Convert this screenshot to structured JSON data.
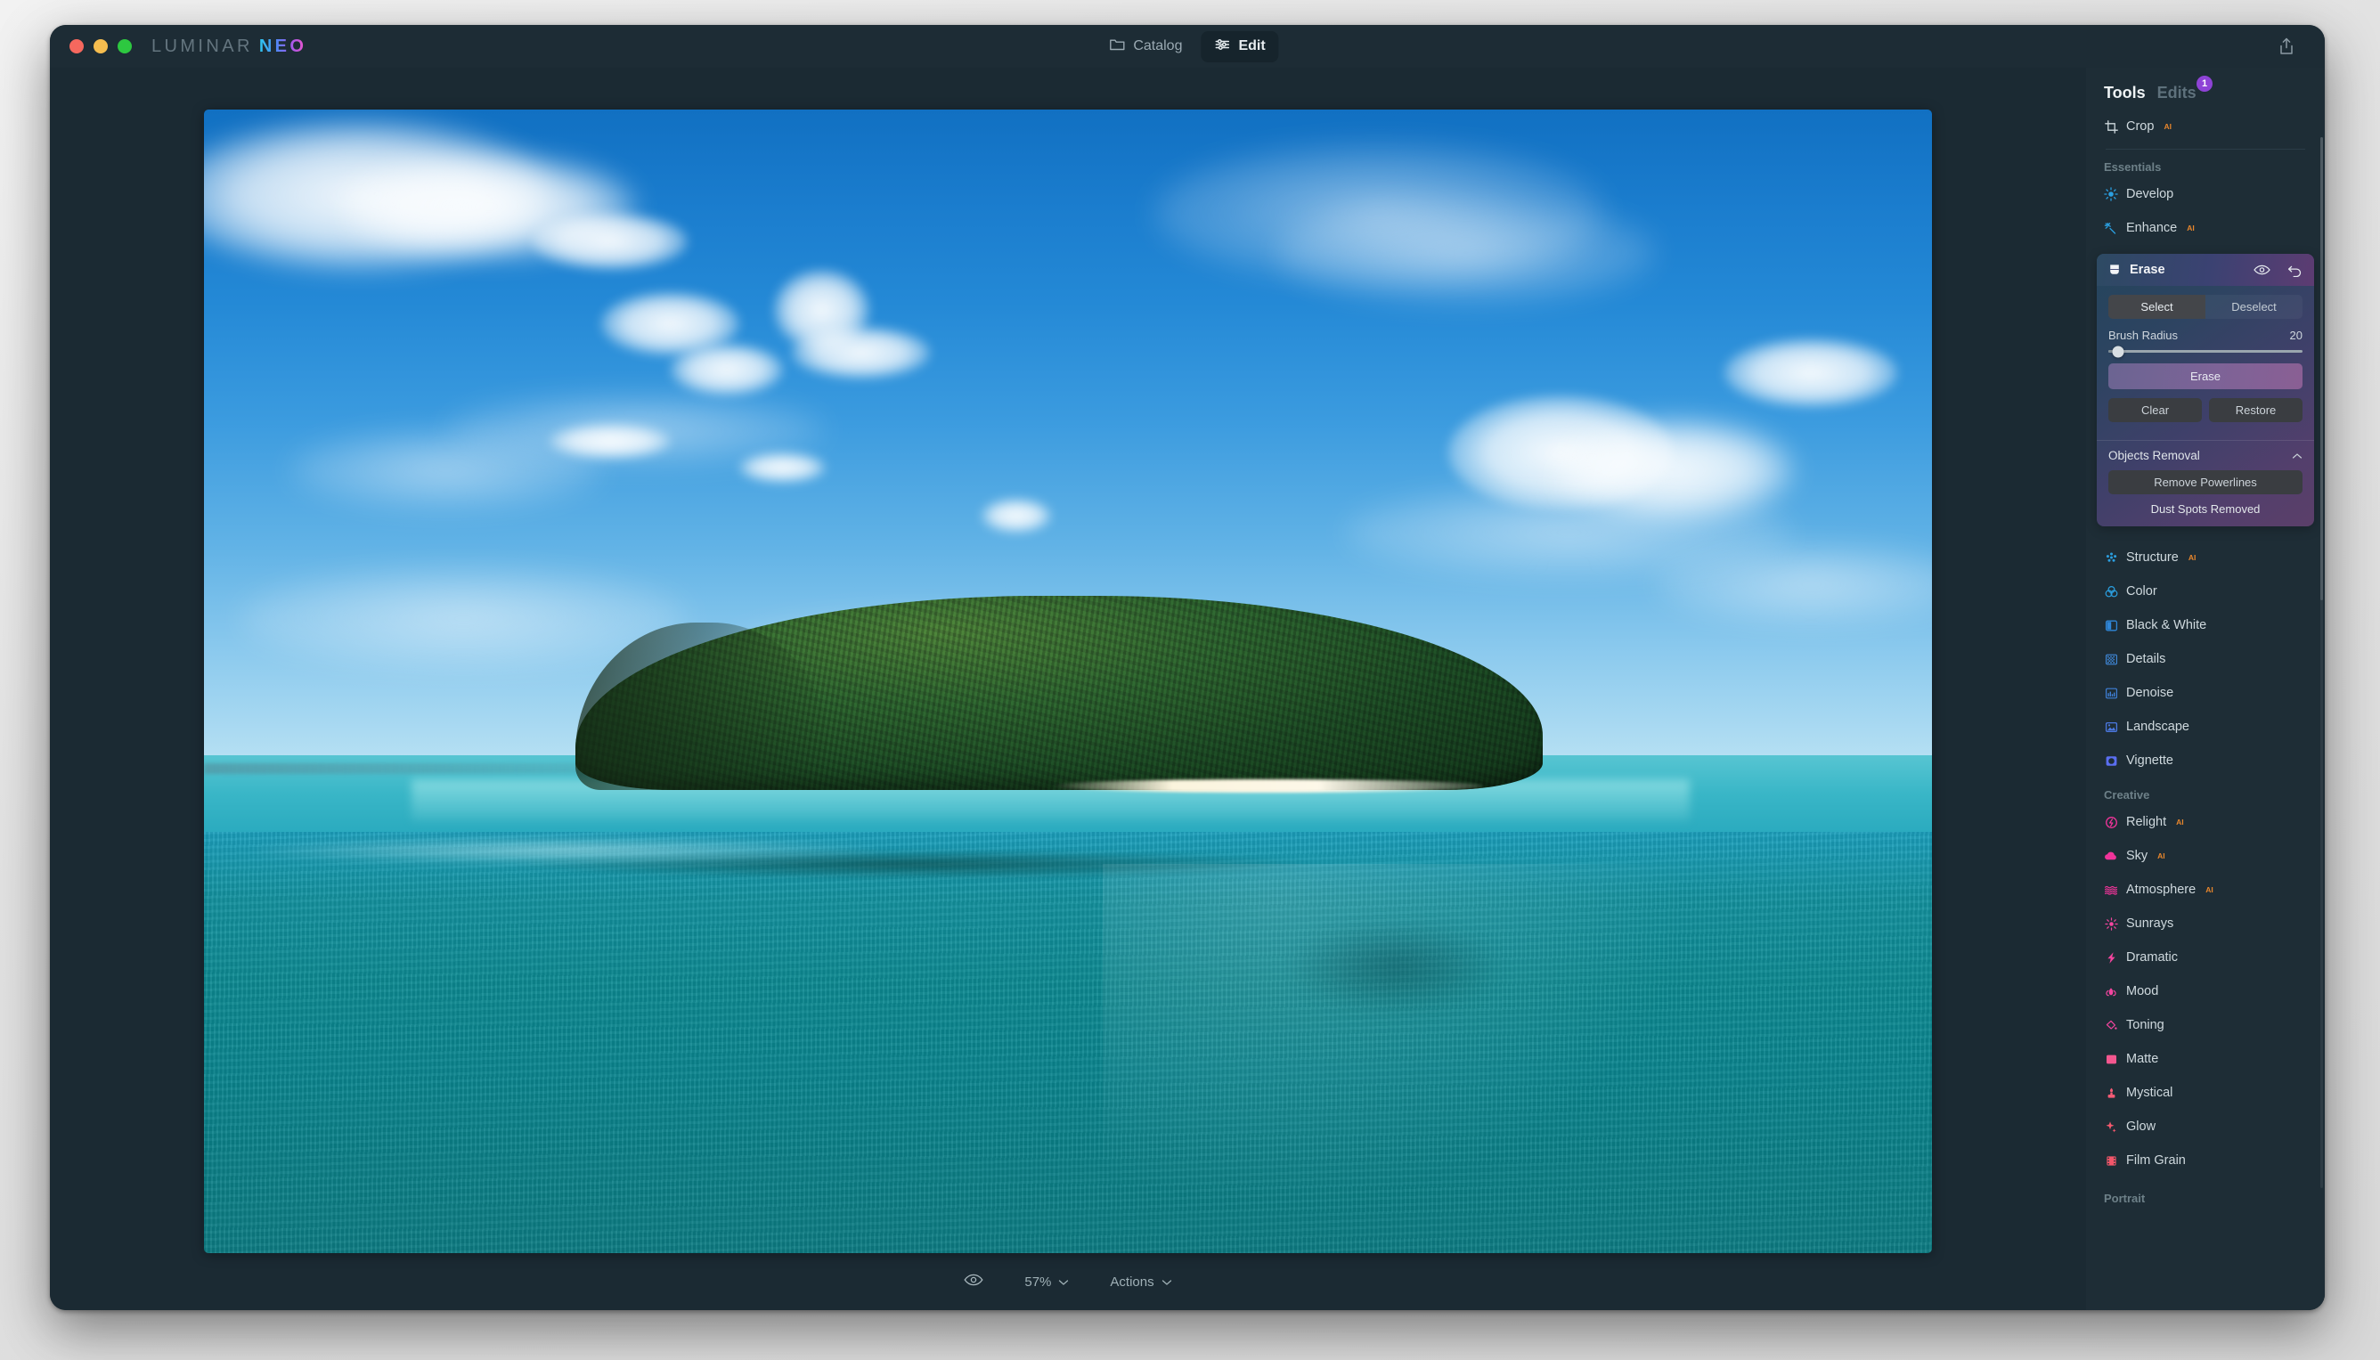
{
  "window": {
    "brand_primary": "LUMINAR",
    "brand_secondary": "NEO",
    "traffic_lights": [
      "close",
      "minimize",
      "zoom"
    ]
  },
  "titlebar": {
    "tabs": [
      {
        "label": "Catalog",
        "icon": "folder-icon",
        "active": false
      },
      {
        "label": "Edit",
        "icon": "sliders-icon",
        "active": true
      }
    ],
    "export_icon": "share-export-icon"
  },
  "bottom_bar": {
    "preview_icon": "eye-icon",
    "zoom_level": "57%",
    "zoom_caret": "chevron-down-icon",
    "actions_label": "Actions",
    "actions_caret": "chevron-down-icon"
  },
  "sidebar": {
    "tabs": [
      {
        "label": "Tools",
        "active": true
      },
      {
        "label": "Edits",
        "active": false
      }
    ],
    "edits_badge": "1",
    "badge_color": "#8e43d6",
    "top_tool": {
      "label": "Crop",
      "icon": "crop-icon",
      "ai": "AI"
    },
    "sections": [
      {
        "title": "Essentials",
        "tools": [
          {
            "label": "Develop",
            "icon": "develop-sun-icon",
            "ai": "",
            "color": "#2b9fe0"
          },
          {
            "label": "Enhance",
            "icon": "enhance-sparkle-icon",
            "ai": "AI",
            "color": "#2b9fe0"
          }
        ]
      },
      {
        "title": "",
        "tools": [
          {
            "label": "Structure",
            "icon": "structure-dots-icon",
            "ai": "AI",
            "color": "#2b9fe0"
          },
          {
            "label": "Color",
            "icon": "color-circles-icon",
            "ai": "",
            "color": "#2b9fe0"
          },
          {
            "label": "Black & White",
            "icon": "black-white-icon",
            "ai": "",
            "color": "#2f86d8"
          },
          {
            "label": "Details",
            "icon": "details-grid-icon",
            "ai": "",
            "color": "#3f87d6"
          },
          {
            "label": "Denoise",
            "icon": "denoise-icon",
            "ai": "",
            "color": "#3f7fd6"
          },
          {
            "label": "Landscape",
            "icon": "landscape-photo-icon",
            "ai": "",
            "color": "#4b78e0"
          },
          {
            "label": "Vignette",
            "icon": "vignette-icon",
            "ai": "",
            "color": "#5a6ef0"
          }
        ]
      },
      {
        "title": "Creative",
        "tools": [
          {
            "label": "Relight",
            "icon": "relight-bolt-icon",
            "ai": "AI",
            "color": "#f0349a"
          },
          {
            "label": "Sky",
            "icon": "cloud-icon",
            "ai": "AI",
            "color": "#f0349a"
          },
          {
            "label": "Atmosphere",
            "icon": "atmosphere-waves-icon",
            "ai": "AI",
            "color": "#f0349a"
          },
          {
            "label": "Sunrays",
            "icon": "sunrays-icon",
            "ai": "",
            "color": "#f3459f"
          },
          {
            "label": "Dramatic",
            "icon": "dramatic-bolt-icon",
            "ai": "",
            "color": "#f3459f"
          },
          {
            "label": "Mood",
            "icon": "mood-flame-icon",
            "ai": "",
            "color": "#f3459f"
          },
          {
            "label": "Toning",
            "icon": "toning-bucket-icon",
            "ai": "",
            "color": "#f3459f"
          },
          {
            "label": "Matte",
            "icon": "matte-square-icon",
            "ai": "",
            "color": "#f4578f"
          },
          {
            "label": "Mystical",
            "icon": "mystical-candle-icon",
            "ai": "",
            "color": "#f45b75"
          },
          {
            "label": "Glow",
            "icon": "glow-sparkle-icon",
            "ai": "",
            "color": "#f4596e"
          },
          {
            "label": "Film Grain",
            "icon": "film-grain-icon",
            "ai": "",
            "color": "#f2566a"
          }
        ]
      },
      {
        "title": "Portrait",
        "tools": []
      }
    ],
    "erase_panel": {
      "title": "Erase",
      "icon": "erase-tool-icon",
      "visibility_icon": "eye-icon",
      "reset_icon": "undo-arrow-icon",
      "segmented": [
        {
          "label": "Select",
          "active": true
        },
        {
          "label": "Deselect",
          "active": false
        }
      ],
      "brush_radius_label": "Brush Radius",
      "brush_radius_value": "20",
      "brush_radius_pct": 5,
      "erase_button": "Erase",
      "erase_button_color": "#7d6397",
      "secondary_buttons": [
        "Clear",
        "Restore"
      ],
      "objects_removal": {
        "title": "Objects Removal",
        "collapse_icon": "chevron-up-icon",
        "remove_powerlines": "Remove Powerlines",
        "dust_spots": "Dust Spots Removed"
      }
    }
  },
  "photo": {
    "subject": "tropical forested island with white sand beach on turquoise sea under blue sky with cumulus clouds"
  }
}
